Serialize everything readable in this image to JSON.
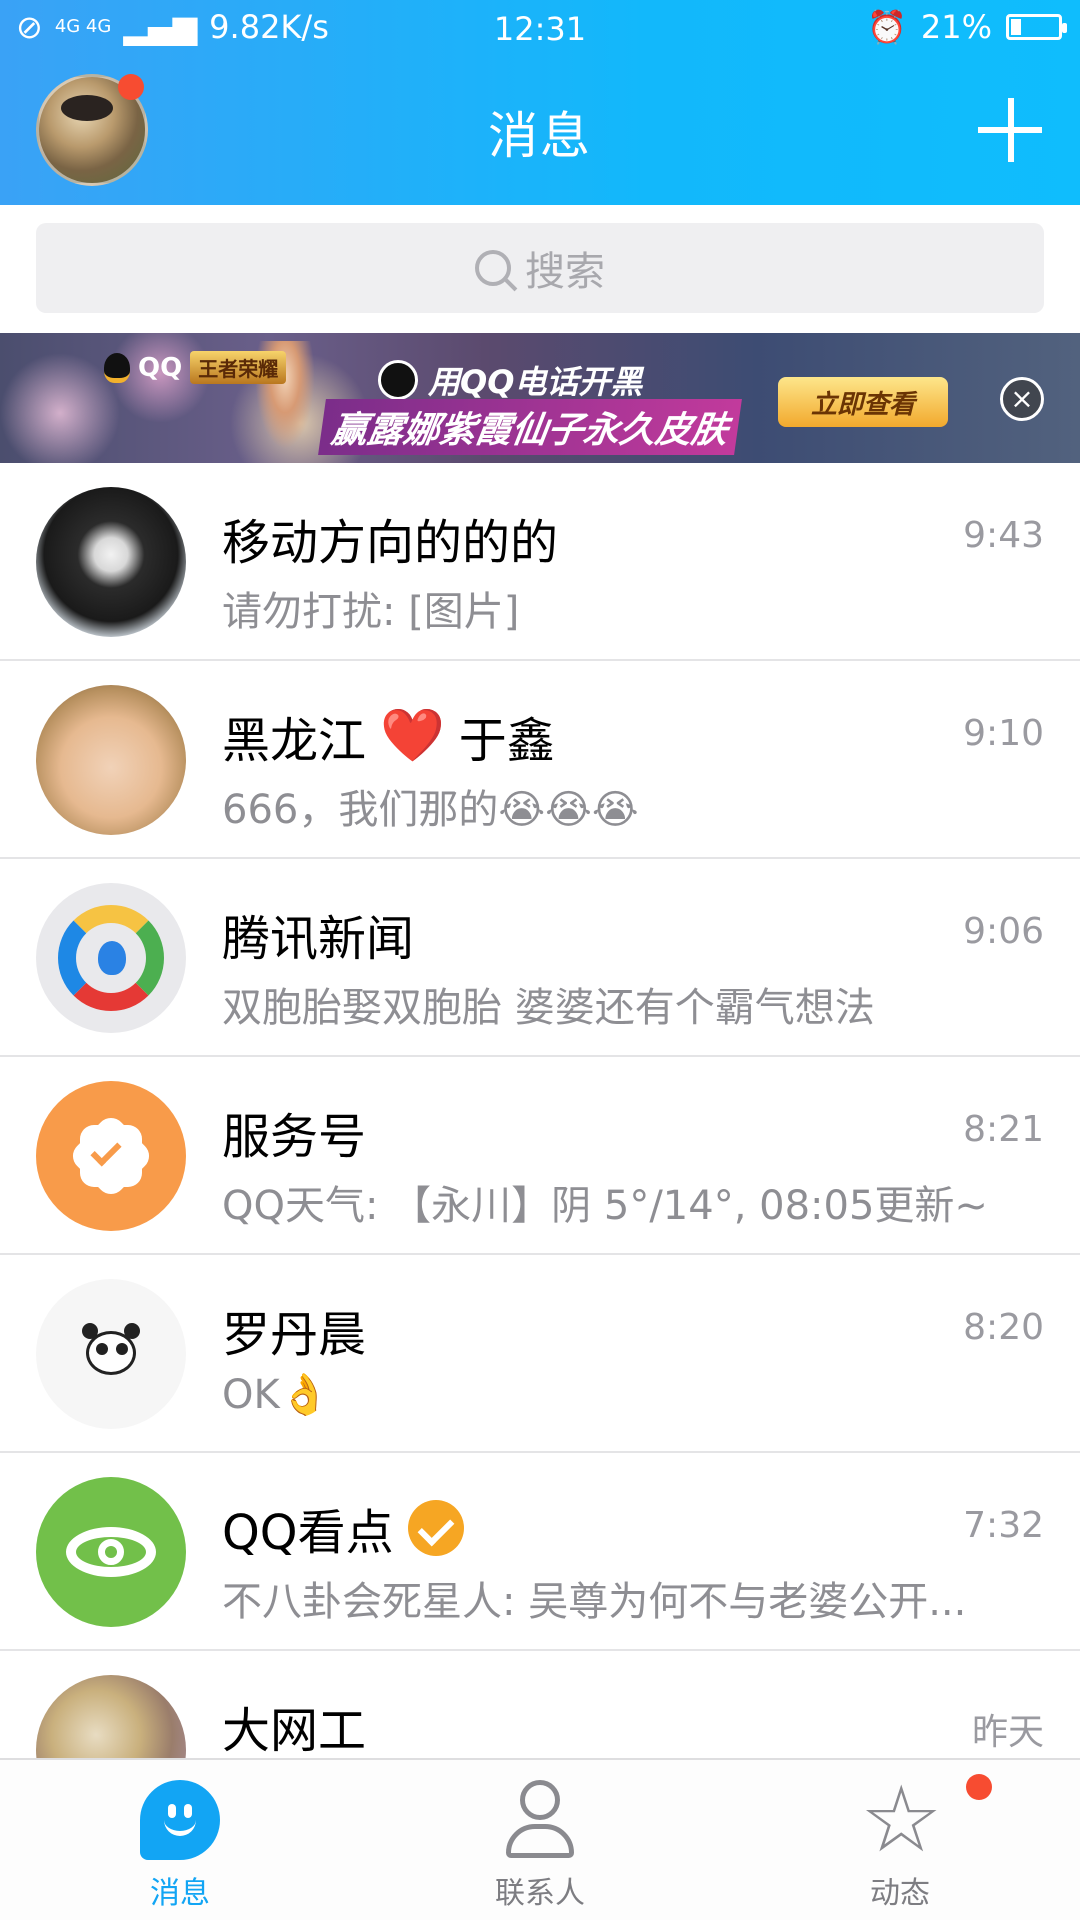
{
  "status_bar": {
    "network": "4G 4G",
    "speed": "9.82K/s",
    "time": "12:31",
    "battery": "21%",
    "battery_level": 0.21
  },
  "header": {
    "title": "消息"
  },
  "search": {
    "placeholder": "搜索"
  },
  "banner": {
    "brand": "QQ",
    "game_badge": "王者荣耀",
    "line1": "用QQ电话开黑",
    "line2": "赢露娜紫霞仙子永久皮肤",
    "cta": "立即查看",
    "close": "×"
  },
  "conversations": [
    {
      "name": "移动方向的的的",
      "message": "请勿打扰: [图片]",
      "time": "9:43",
      "avatar": "dog-photo"
    },
    {
      "name_prefix": "黑龙江",
      "name_suffix": "于鑫",
      "message": "666，我们那的😭😭😭",
      "time": "9:10",
      "avatar": "baby-photo",
      "emoji": "❤️"
    },
    {
      "name": "腾讯新闻",
      "message": "双胞胎娶双胞胎 婆婆还有个霸气想法",
      "time": "9:06",
      "avatar": "tencent-news-logo"
    },
    {
      "name": "服务号",
      "message": "QQ天气: 【永川】阴 5°/14°, 08:05更新~",
      "time": "8:21",
      "avatar": "service-badge"
    },
    {
      "name": "罗丹晨",
      "message": "OK👌",
      "time": "8:20",
      "avatar": "panda-sticker"
    },
    {
      "name": "QQ看点",
      "message": "不八卦会死星人: 吴尊为何不与老婆公开...",
      "time": "7:32",
      "avatar": "kandian-eye-logo"
    },
    {
      "name": "大网工",
      "message": "",
      "time": "昨天",
      "avatar": "painting-photo"
    }
  ],
  "tabbar": {
    "tabs": [
      {
        "label": "消息",
        "active": true
      },
      {
        "label": "联系人",
        "active": false
      },
      {
        "label": "动态",
        "active": false
      }
    ]
  },
  "colors": {
    "header_start": "#3aa2f6",
    "header_end": "#0fbdfd",
    "accent": "#12a5f4",
    "badge_red": "#f74c31",
    "verify_orange": "#f6a623"
  }
}
